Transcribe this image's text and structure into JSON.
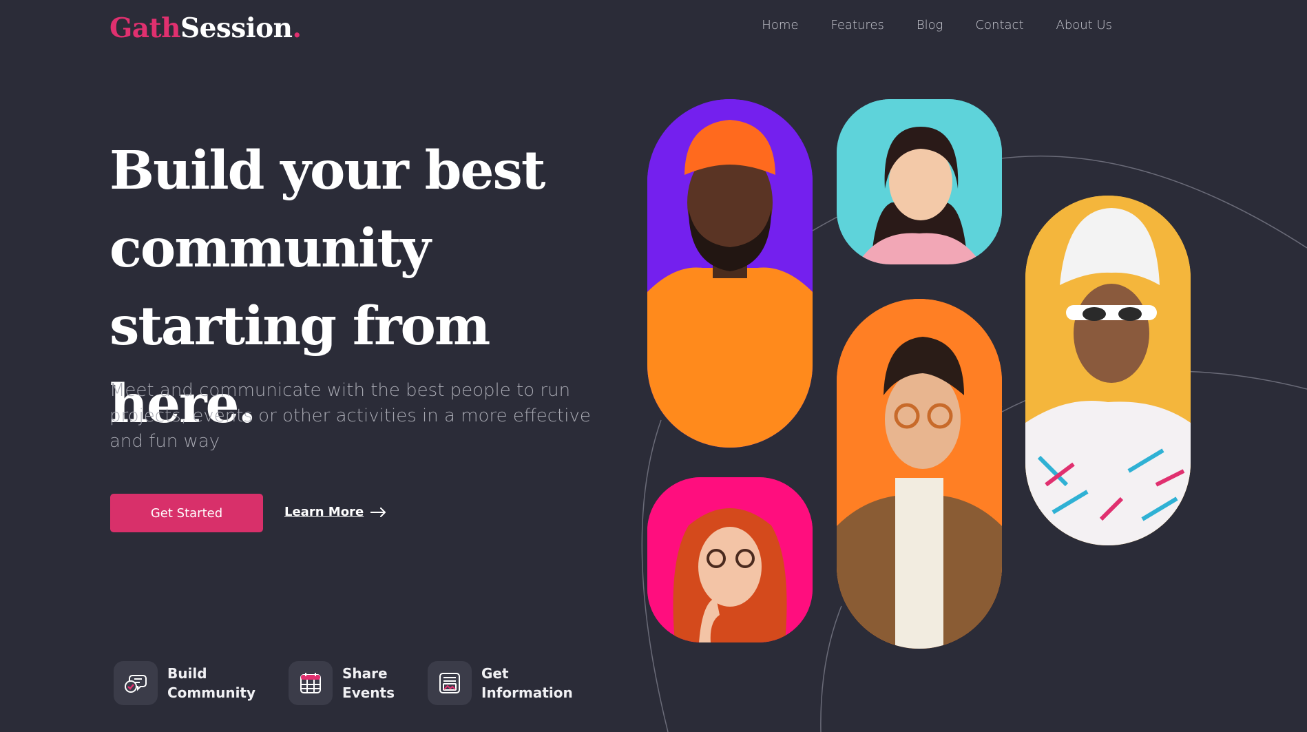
{
  "brand": {
    "part1": "Gath",
    "part2": "Session",
    "dot": ".",
    "accent_color": "#e0306f"
  },
  "nav": {
    "items": [
      {
        "label": "Home"
      },
      {
        "label": "Features"
      },
      {
        "label": "Blog"
      },
      {
        "label": "Contact"
      },
      {
        "label": "About Us"
      }
    ]
  },
  "hero": {
    "title_line1": "Build your best",
    "title_line2": "community",
    "title_line3": "starting from here.",
    "subtitle": "Meet and communicate with the best people to run projects, events or other activities in a more effective and fun way",
    "primary_button": "Get Started",
    "secondary_link": "Learn More",
    "secondary_icon": "arrow-right-icon"
  },
  "features": [
    {
      "label": "Build\nCommunity",
      "icon": "chat-community-icon"
    },
    {
      "label": "Share\nEvents",
      "icon": "calendar-icon"
    },
    {
      "label": "Get\nInformation",
      "icon": "info-card-icon"
    }
  ],
  "gallery": {
    "cards": [
      {
        "subject": "man-orange-beanie",
        "bg_color": "#7420ee"
      },
      {
        "subject": "woman-smiling-pink-sweater",
        "bg_color": "#5ed3da"
      },
      {
        "subject": "woman-towel-sunglasses",
        "bg_color": "#f4b63c"
      },
      {
        "subject": "man-glasses-brown-jacket",
        "bg_color": "#ff7f24"
      },
      {
        "subject": "woman-redhead-thinking",
        "bg_color": "#ff0e7e"
      }
    ]
  },
  "colors": {
    "background": "#2b2c38",
    "primary": "#d8306a",
    "muted_text": "#a8a9b2"
  }
}
